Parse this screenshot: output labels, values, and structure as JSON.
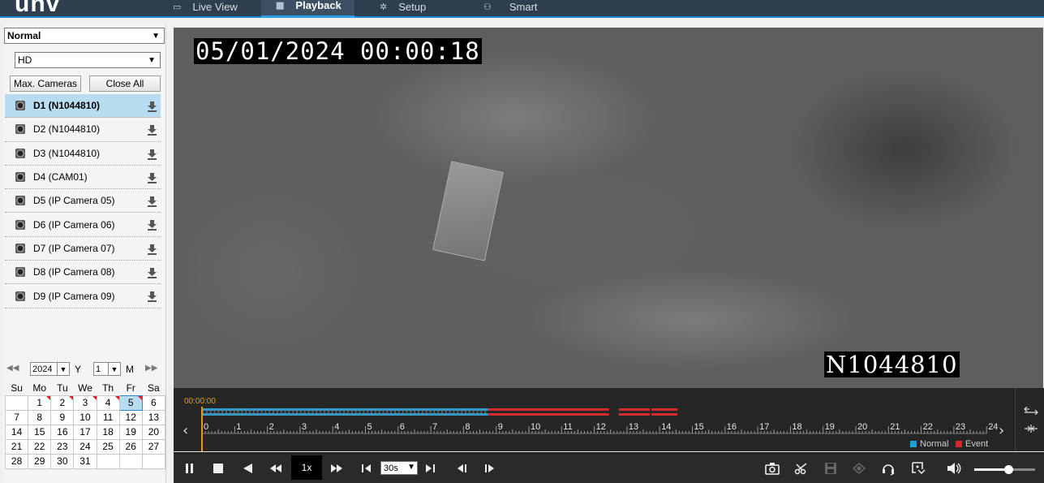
{
  "nav": {
    "logo": "unv",
    "tabs": [
      {
        "label": "Live View",
        "active": false
      },
      {
        "label": "Playback",
        "active": true
      },
      {
        "label": "Setup",
        "active": false
      },
      {
        "label": "Smart",
        "active": false
      }
    ]
  },
  "left": {
    "mode_select": "Normal",
    "quality_select": "HD",
    "max_cameras_label": "Max. Cameras",
    "close_all_label": "Close All",
    "cameras": [
      {
        "label": "D1 (N1044810)",
        "selected": true
      },
      {
        "label": "D2 (N1044810)",
        "selected": false
      },
      {
        "label": "D3 (N1044810)",
        "selected": false
      },
      {
        "label": "D4 (CAM01)",
        "selected": false
      },
      {
        "label": "D5 (IP Camera 05)",
        "selected": false
      },
      {
        "label": "D6 (IP Camera 06)",
        "selected": false
      },
      {
        "label": "D7 (IP Camera 07)",
        "selected": false
      },
      {
        "label": "D8 (IP Camera 08)",
        "selected": false
      },
      {
        "label": "D9 (IP Camera 09)",
        "selected": false
      }
    ]
  },
  "calendar": {
    "year": "2024",
    "year_label": "Y",
    "month": "1",
    "month_label": "M",
    "weekdays": [
      "Su",
      "Mo",
      "Tu",
      "We",
      "Th",
      "Fr",
      "Sa"
    ],
    "weeks": [
      [
        "",
        "1",
        "2",
        "3",
        "4",
        "5",
        "6"
      ],
      [
        "7",
        "8",
        "9",
        "10",
        "11",
        "12",
        "13"
      ],
      [
        "14",
        "15",
        "16",
        "17",
        "18",
        "19",
        "20"
      ],
      [
        "21",
        "22",
        "23",
        "24",
        "25",
        "26",
        "27"
      ],
      [
        "28",
        "29",
        "30",
        "31",
        "",
        "",
        ""
      ]
    ],
    "record_days": [
      "1",
      "2",
      "3",
      "4",
      "5"
    ],
    "selected_day": "5"
  },
  "video": {
    "timestamp": "05/01/2024 00:00:18",
    "camera_overlay": "N1044810"
  },
  "timeline": {
    "start_time": "00:00:00",
    "hours": [
      "0",
      "1",
      "2",
      "3",
      "4",
      "5",
      "6",
      "7",
      "8",
      "9",
      "10",
      "11",
      "12",
      "13",
      "14",
      "15",
      "16",
      "17",
      "18",
      "19",
      "20",
      "21",
      "22",
      "23",
      "24"
    ],
    "normal_color": "#1e9fd8",
    "event_color": "#d22b2b",
    "legend_normal": "Normal",
    "legend_event": "Event"
  },
  "controls": {
    "speed": "1x",
    "interval": "30s",
    "volume_level": 0.5
  }
}
